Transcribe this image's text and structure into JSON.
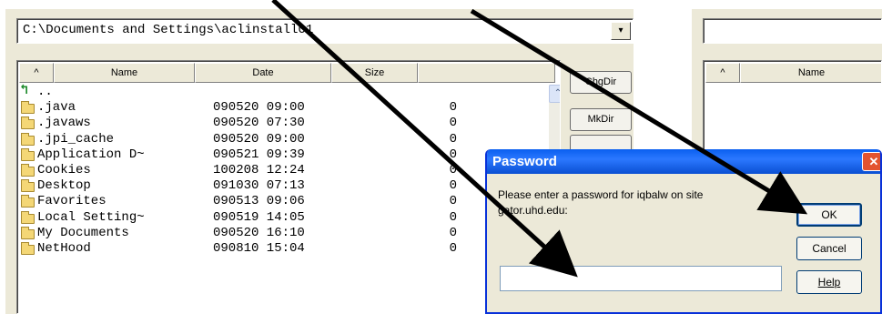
{
  "left_pane": {
    "path": "C:\\Documents and Settings\\aclinstall01",
    "dropdown_glyph": "▾",
    "columns": [
      "^",
      "Name",
      "Date",
      "Size"
    ],
    "rows": [
      {
        "name": "..",
        "date": "",
        "size": "",
        "icon": "up-folder-icon"
      },
      {
        "name": ".java",
        "date": "090520 09:00",
        "size": "0",
        "icon": "folder-icon"
      },
      {
        "name": ".javaws",
        "date": "090520 07:30",
        "size": "0",
        "icon": "folder-icon"
      },
      {
        "name": ".jpi_cache",
        "date": "090520 09:00",
        "size": "0",
        "icon": "folder-icon"
      },
      {
        "name": "Application D~",
        "date": "090521 09:39",
        "size": "0",
        "icon": "folder-icon"
      },
      {
        "name": "Cookies",
        "date": "100208 12:24",
        "size": "0",
        "icon": "folder-icon"
      },
      {
        "name": "Desktop",
        "date": "091030 07:13",
        "size": "0",
        "icon": "folder-icon"
      },
      {
        "name": "Favorites",
        "date": "090513 09:06",
        "size": "0",
        "icon": "folder-icon"
      },
      {
        "name": "Local Setting~",
        "date": "090519 14:05",
        "size": "0",
        "icon": "folder-icon"
      },
      {
        "name": "My Documents",
        "date": "090520 16:10",
        "size": "0",
        "icon": "folder-icon"
      },
      {
        "name": "NetHood",
        "date": "090810 15:04",
        "size": "0",
        "icon": "folder-icon"
      }
    ],
    "scroll_up_glyph": "⌃",
    "buttons": {
      "chgdir": "ChgDir",
      "mkdir": "MkDir"
    }
  },
  "right_pane": {
    "path": "",
    "columns": [
      "^",
      "Name"
    ]
  },
  "dialog": {
    "title": "Password",
    "close_glyph": "✕",
    "prompt": "Please enter a password for iqbalw on site gator.uhd.edu:",
    "password_value": "",
    "ok_label": "OK",
    "cancel_label": "Cancel",
    "help_label": "Help"
  },
  "annotation": {
    "arrow_color": "#000000",
    "icon": "pointer-arrow"
  }
}
